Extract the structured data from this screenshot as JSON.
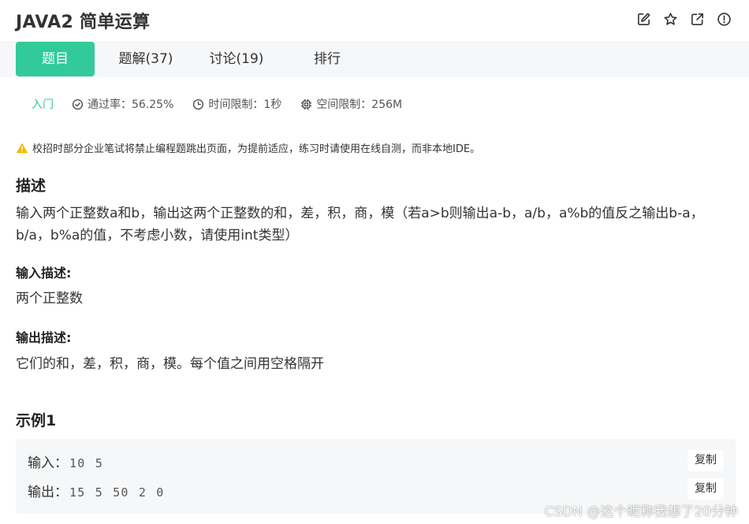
{
  "header": {
    "title": "JAVA2  简单运算",
    "icons": [
      "edit-icon",
      "star-icon",
      "external-link-icon",
      "info-icon"
    ]
  },
  "tabs": [
    {
      "label": "题目",
      "active": true
    },
    {
      "label": "题解(37)",
      "active": false
    },
    {
      "label": "讨论(19)",
      "active": false
    },
    {
      "label": "排行",
      "active": false
    }
  ],
  "meta": {
    "level": "入门",
    "pass_rate": "通过率：56.25%",
    "time_limit": "时间限制：1秒",
    "memory_limit": "空间限制：256M"
  },
  "notice": "校招时部分企业笔试将禁止编程题跳出页面，为提前适应，练习时请使用在线自测，而非本地IDE。",
  "description": {
    "heading": "描述",
    "text": "输入两个正整数a和b，输出这两个正整数的和，差，积，商，模（若a>b则输出a-b，a/b，a%b的值反之输出b-a，b/a，b%a的值，不考虑小数，请使用int类型）"
  },
  "input_desc": {
    "heading": "输入描述:",
    "text": "两个正整数"
  },
  "output_desc": {
    "heading": "输出描述:",
    "text": "它们的和，差，积，商，模。每个值之间用空格隔开"
  },
  "example": {
    "heading": "示例1",
    "input_label": "输入：",
    "input_value": "10 5",
    "output_label": "输出：",
    "output_value": "15 5 50 2 0",
    "copy_label": "复制"
  },
  "colors": {
    "accent": "#32ca99",
    "warning": "#f5b800",
    "tab_bar_bg": "#f6f7f8"
  },
  "watermark": "CSDN @这个昵称我想了20分钟"
}
